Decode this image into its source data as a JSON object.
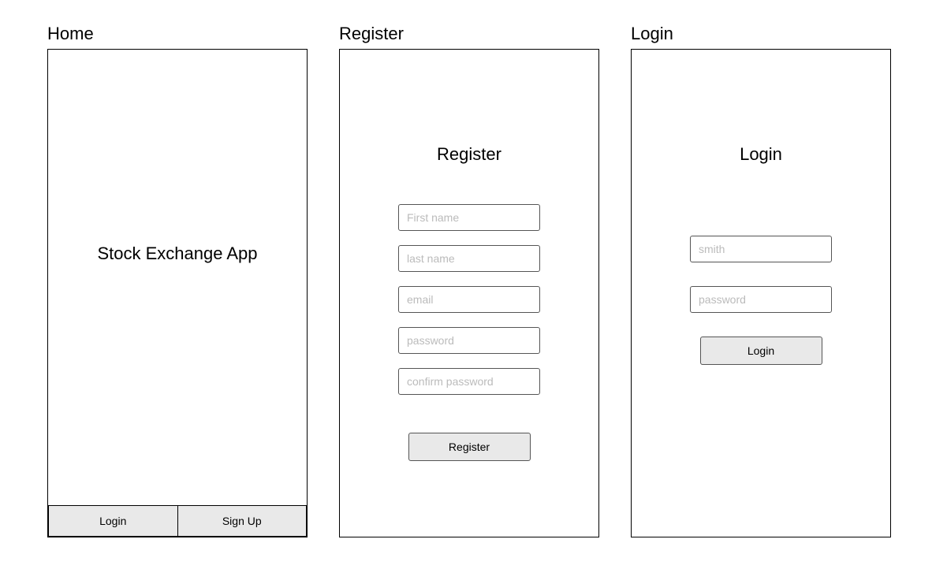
{
  "home": {
    "screen_label": "Home",
    "app_title": "Stock Exchange App",
    "login_button": "Login",
    "signup_button": "Sign Up"
  },
  "register": {
    "screen_label": "Register",
    "heading": "Register",
    "fields": {
      "first_name_placeholder": "First name",
      "last_name_placeholder": "last name",
      "email_placeholder": "email",
      "password_placeholder": "password",
      "confirm_password_placeholder": "confirm password"
    },
    "submit_button": "Register"
  },
  "login": {
    "screen_label": "Login",
    "heading": "Login",
    "fields": {
      "username_placeholder": "smith",
      "password_placeholder": "password"
    },
    "submit_button": "Login"
  }
}
